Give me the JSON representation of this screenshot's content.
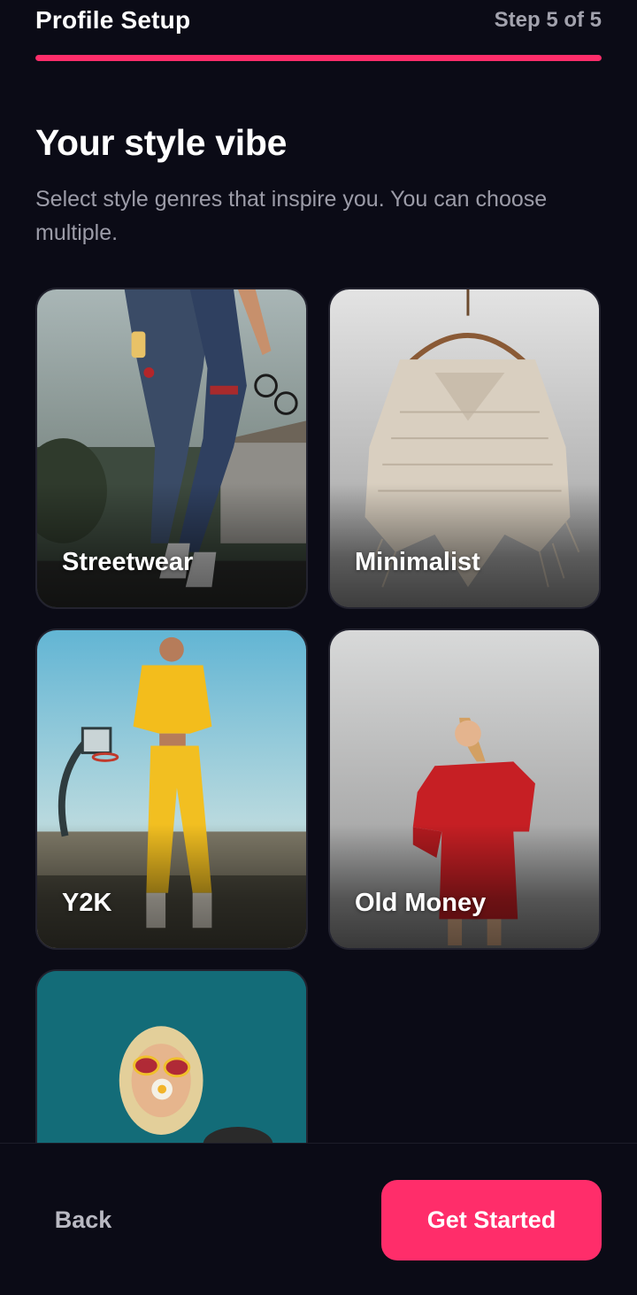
{
  "header": {
    "title": "Profile Setup",
    "step": "Step 5 of 5",
    "progress": 1.0,
    "accent_color": "#ff2d6a"
  },
  "intro": {
    "heading": "Your style vibe",
    "subtitle": "Select style genres that inspire you. You can choose multiple."
  },
  "genres": [
    {
      "label": "Streetwear"
    },
    {
      "label": "Minimalist"
    },
    {
      "label": "Y2K"
    },
    {
      "label": "Old Money"
    },
    {
      "label": ""
    }
  ],
  "footer": {
    "back_label": "Back",
    "primary_label": "Get Started"
  }
}
